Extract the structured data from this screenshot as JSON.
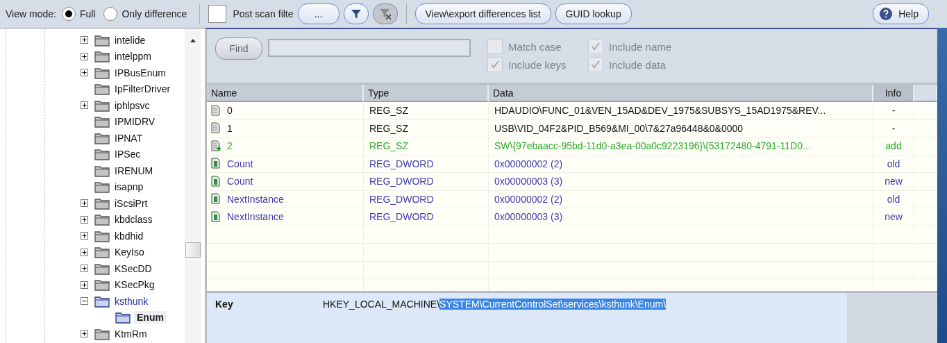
{
  "toolbar": {
    "view_mode_label": "View mode:",
    "view_modes": [
      {
        "label": "Full",
        "selected": true
      },
      {
        "label": "Only difference",
        "selected": false
      }
    ],
    "post_scan_filter": {
      "label": "Post scan filte",
      "checked": false
    },
    "buttons": [
      {
        "kind": "text",
        "label": "...",
        "disabled": false
      },
      {
        "kind": "filter",
        "disabled": false
      },
      {
        "kind": "clear-filter",
        "disabled": true
      },
      {
        "kind": "text",
        "label": "View\\export differences list",
        "disabled": false
      },
      {
        "kind": "text",
        "label": "GUID lookup",
        "disabled": false
      }
    ],
    "help": {
      "label": "Help"
    }
  },
  "tree": {
    "items": [
      {
        "label": "intelide",
        "expandable": true,
        "expanded": false,
        "selected": false
      },
      {
        "label": "intelppm",
        "expandable": true,
        "expanded": false,
        "selected": false
      },
      {
        "label": "IPBusEnum",
        "expandable": true,
        "expanded": false,
        "selected": false
      },
      {
        "label": "IpFilterDriver",
        "expandable": false,
        "expanded": false,
        "selected": false
      },
      {
        "label": "iphlpsvc",
        "expandable": true,
        "expanded": false,
        "selected": false
      },
      {
        "label": "IPMIDRV",
        "expandable": false,
        "expanded": false,
        "selected": false
      },
      {
        "label": "IPNAT",
        "expandable": false,
        "expanded": false,
        "selected": false
      },
      {
        "label": "IPSec",
        "expandable": false,
        "expanded": false,
        "selected": false
      },
      {
        "label": "IRENUM",
        "expandable": false,
        "expanded": false,
        "selected": false
      },
      {
        "label": "isapnp",
        "expandable": false,
        "expanded": false,
        "selected": false
      },
      {
        "label": "iScsiPrt",
        "expandable": true,
        "expanded": false,
        "selected": false
      },
      {
        "label": "kbdclass",
        "expandable": true,
        "expanded": false,
        "selected": false
      },
      {
        "label": "kbdhid",
        "expandable": true,
        "expanded": false,
        "selected": false
      },
      {
        "label": "KeyIso",
        "expandable": true,
        "expanded": false,
        "selected": false
      },
      {
        "label": "KSecDD",
        "expandable": true,
        "expanded": false,
        "selected": false
      },
      {
        "label": "KSecPkg",
        "expandable": true,
        "expanded": false,
        "selected": false
      },
      {
        "label": "ksthunk",
        "expandable": true,
        "expanded": true,
        "selected": false,
        "children": [
          {
            "label": "Enum",
            "expandable": false,
            "expanded": false,
            "selected": true
          }
        ]
      },
      {
        "label": "KtmRm",
        "expandable": true,
        "expanded": false,
        "selected": false
      }
    ]
  },
  "search": {
    "button": "Find",
    "options": [
      {
        "label": "Match case",
        "checked": false,
        "disabled": true
      },
      {
        "label": "Include name",
        "checked": true,
        "disabled": true
      },
      {
        "label": "Include keys",
        "checked": true,
        "disabled": true
      },
      {
        "label": "Include data",
        "checked": true,
        "disabled": true
      }
    ]
  },
  "table": {
    "columns": [
      "Name",
      "Type",
      "Data",
      "Info"
    ],
    "rows": [
      {
        "kind": "string",
        "color": "#111111",
        "name": "0",
        "type": "REG_SZ",
        "data": "HDAUDIO\\FUNC_01&VEN_15AD&DEV_1975&SUBSYS_15AD1975&REV...",
        "info": "-"
      },
      {
        "kind": "string",
        "color": "#111111",
        "name": "1",
        "type": "REG_SZ",
        "data": "USB\\VID_04F2&PID_B569&MI_00\\7&27a96448&0&0000",
        "info": "-"
      },
      {
        "kind": "added",
        "color": "#2aa82a",
        "name": "2",
        "type": "REG_SZ",
        "data": "SW\\{97ebaacc-95bd-11d0-a3ea-00a0c9223196}\\{53172480-4791-11D0...",
        "info": "add"
      },
      {
        "kind": "dword",
        "color": "#3a3ab0",
        "name": "Count",
        "type": "REG_DWORD",
        "data": "0x00000002 (2)",
        "info": "old"
      },
      {
        "kind": "dword",
        "color": "#3a3ab0",
        "name": "Count",
        "type": "REG_DWORD",
        "data": "0x00000003 (3)",
        "info": "new"
      },
      {
        "kind": "dword",
        "color": "#3a3ab0",
        "name": "NextInstance",
        "type": "REG_DWORD",
        "data": "0x00000002 (2)",
        "info": "old"
      },
      {
        "kind": "dword",
        "color": "#3a3ab0",
        "name": "NextInstance",
        "type": "REG_DWORD",
        "data": "0x00000003 (3)",
        "info": "new"
      }
    ]
  },
  "key_panel": {
    "label": "Key",
    "path": [
      {
        "text": "HKEY_LOCAL_MACHINE\\",
        "selected": false
      },
      {
        "text": "SYSTEM\\CurrentControlSet\\services\\ksthunk\\Enum\\",
        "selected": true
      }
    ]
  }
}
